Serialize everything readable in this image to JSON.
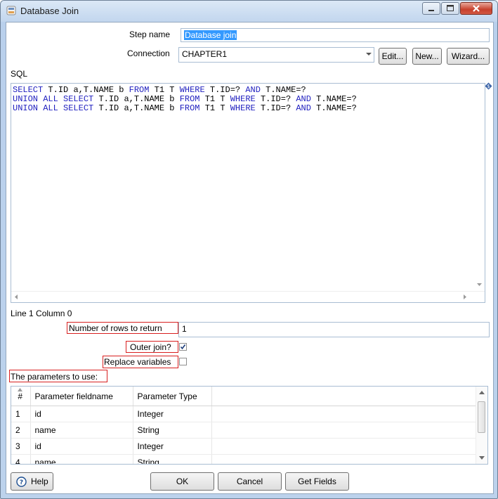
{
  "window": {
    "title": "Database Join"
  },
  "form": {
    "step_name_label": "Step name",
    "step_name_value": "Database join",
    "connection_label": "Connection",
    "connection_value": "CHAPTER1",
    "edit_label": "Edit...",
    "new_label": "New...",
    "wizard_label": "Wizard...",
    "sql_label": "SQL",
    "sql_lines": [
      "SELECT T.ID a,T.NAME b FROM T1 T WHERE T.ID=? AND T.NAME=?",
      "UNION ALL SELECT T.ID a,T.NAME b FROM T1 T WHERE T.ID=? AND T.NAME=?",
      "UNION ALL SELECT T.ID a,T.NAME b FROM T1 T WHERE T.ID=? AND T.NAME=?"
    ],
    "cursor_status": "Line 1 Column 0",
    "rows_label": "Number of rows to return",
    "rows_value": "1",
    "outer_join_label": "Outer join?",
    "outer_join_checked": true,
    "replace_vars_label": "Replace variables",
    "replace_vars_checked": false,
    "params_label": "The parameters to use:"
  },
  "params_table": {
    "columns": [
      "#",
      "Parameter fieldname",
      "Parameter Type"
    ],
    "rows": [
      {
        "n": "1",
        "field": "id",
        "type": "Integer"
      },
      {
        "n": "2",
        "field": "name",
        "type": "String"
      },
      {
        "n": "3",
        "field": "id",
        "type": "Integer"
      },
      {
        "n": "4",
        "field": "name",
        "type": "String"
      }
    ]
  },
  "footer": {
    "help_label": "Help",
    "ok_label": "OK",
    "cancel_label": "Cancel",
    "get_fields_label": "Get Fields"
  },
  "colors": {
    "annotation_red": "#d81f1f",
    "sql_keyword": "#1f1fbf",
    "selection": "#3399ff"
  }
}
